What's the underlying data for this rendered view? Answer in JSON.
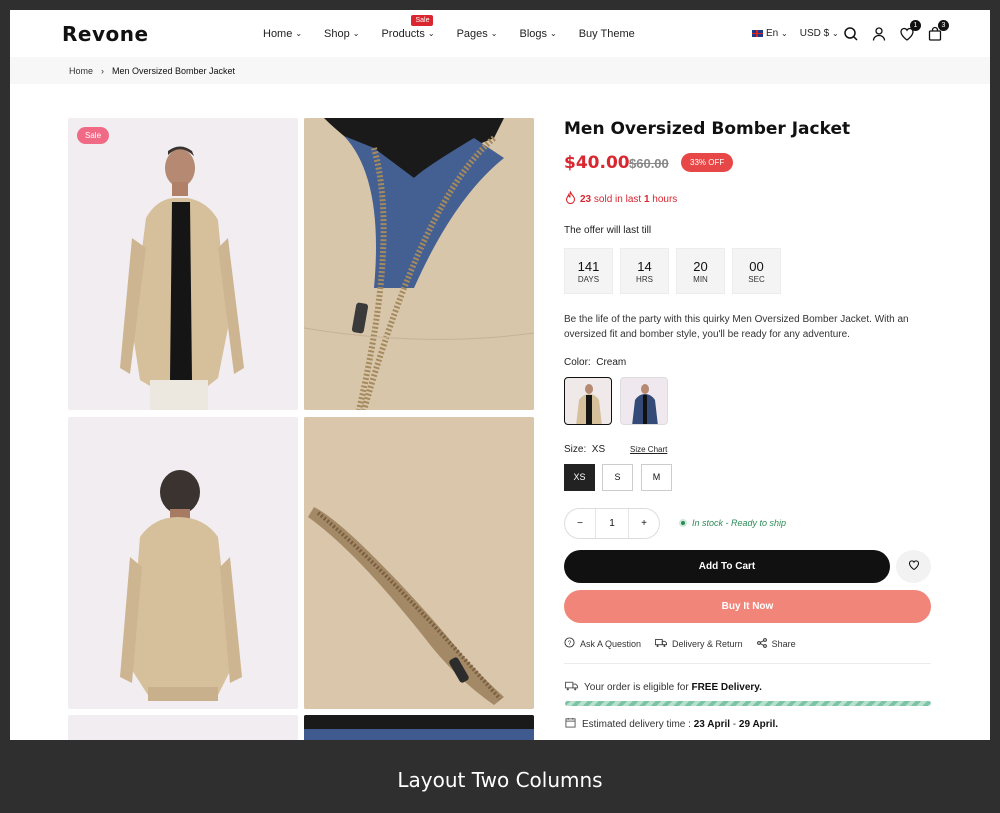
{
  "brand": {
    "logo": "Revone"
  },
  "nav": {
    "items": [
      {
        "label": "Home"
      },
      {
        "label": "Shop"
      },
      {
        "label": "Products",
        "badge": "Sale"
      },
      {
        "label": "Pages"
      },
      {
        "label": "Blogs"
      },
      {
        "label": "Buy Theme"
      }
    ]
  },
  "header_right": {
    "language": "En",
    "currency": "USD $",
    "wishlist_count": "1",
    "cart_count": "3"
  },
  "breadcrumb": {
    "home": "Home",
    "separator": "›",
    "current": "Men Oversized Bomber Jacket"
  },
  "gallery": {
    "sale_tag": "Sale"
  },
  "product": {
    "title": "Men Oversized Bomber Jacket",
    "price": "$40.00",
    "old_price": "$60.00",
    "discount": "33% OFF",
    "sold_count": "23",
    "sold_text_mid": "sold in last",
    "sold_hours": "1",
    "sold_text_end": "hours",
    "offer_text": "The offer will last till",
    "countdown": [
      {
        "value": "141",
        "unit": "DAYS"
      },
      {
        "value": "14",
        "unit": "HRS"
      },
      {
        "value": "20",
        "unit": "MIN"
      },
      {
        "value": "00",
        "unit": "SEC"
      }
    ],
    "description": "Be the life of the party with this quirky Men Oversized Bomber Jacket. With an oversized fit and bomber style, you'll be ready for any adventure.",
    "color_label": "Color:",
    "color_value": "Cream",
    "size_label": "Size:",
    "size_value": "XS",
    "size_chart": "Size Chart",
    "sizes": [
      "XS",
      "S",
      "M"
    ],
    "quantity": "1",
    "qty_minus": "−",
    "qty_plus": "+",
    "stock": "In stock - Ready to ship",
    "add_to_cart": "Add To Cart",
    "buy_now": "Buy It Now",
    "links": [
      "Ask A Question",
      "Delivery & Return",
      "Share"
    ],
    "delivery_text": "Your order is eligible for",
    "delivery_bold": "FREE Delivery.",
    "est_text": "Estimated delivery time :",
    "est_from": "23 April",
    "est_sep": " - ",
    "est_to": "29 April."
  },
  "caption": "Layout Two Columns",
  "colors": {
    "accent_red": "#d9262f",
    "buy_now": "#f2857a",
    "dark": "#111111",
    "stock_green": "#2e8b57"
  }
}
